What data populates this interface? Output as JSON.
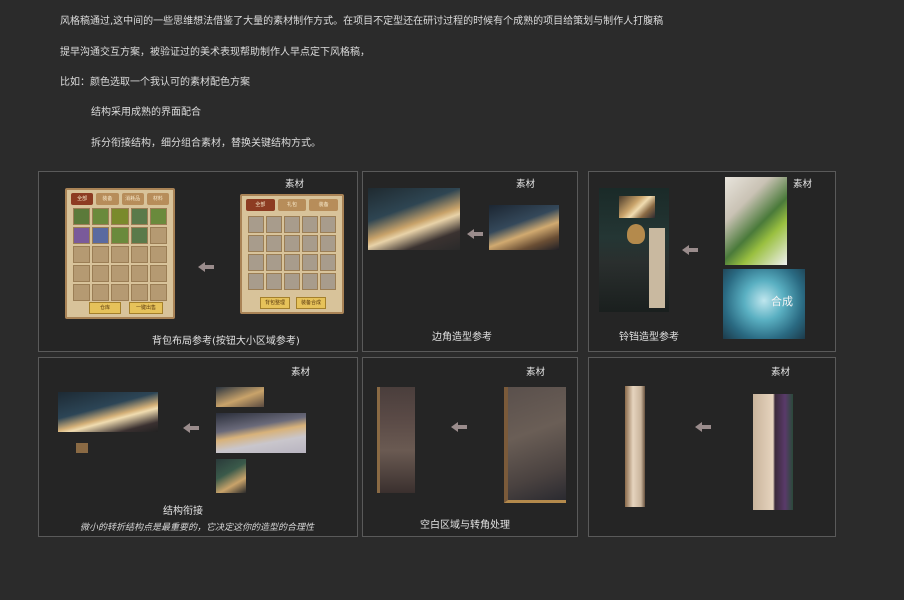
{
  "intro": {
    "line1": "风格稿通过,这中间的一些思维想法借鉴了大量的素材制作方式。在项目不定型还在研讨过程的时候有个成熟的项目给策划与制作人打腹稿",
    "line2": "提早沟通交互方案，被验证过的美术表现帮助制作人早点定下风格稿，",
    "line3": "比如：颜色选取一个我认可的素材配色方案",
    "line4": "结构采用成熟的界面配合",
    "line5": "拆分衔接结构，细分组合素材，替换关键结构方式。"
  },
  "panels": [
    {
      "tag": "素材",
      "caption": "背包布局参考(按钮大小区域参考)"
    },
    {
      "tag": "素材",
      "caption": "边角造型参考"
    },
    {
      "tag": "素材",
      "caption": "铃铛造型参考"
    },
    {
      "tag": "素材",
      "caption": "结构衔接",
      "subcaption": "微小的转折结构点是最重要的，它决定这你的造型的合理性"
    },
    {
      "tag": "素材",
      "caption": "空白区域与转角处理"
    },
    {
      "tag": "素材",
      "caption": ""
    }
  ],
  "inventory": {
    "tabs_left": [
      "全部",
      "装备",
      "消耗品",
      "材料"
    ],
    "buttons_left": [
      "仓库",
      "一键出售"
    ],
    "tabs_right": [
      "全部",
      "礼包",
      "装备"
    ],
    "buttons_right": [
      "背包整理",
      "装备合成"
    ]
  },
  "ad_text": "合成",
  "colors": {
    "background": "#2b2b2b",
    "panel_border": "#5a5a5a",
    "arrow": "#9a8c8c"
  }
}
